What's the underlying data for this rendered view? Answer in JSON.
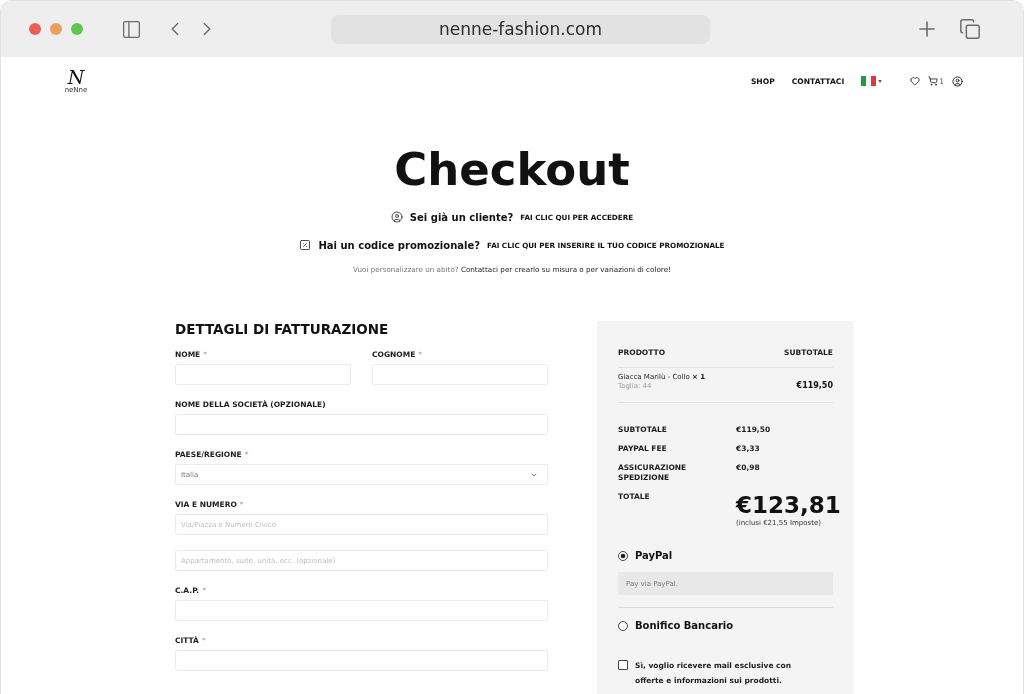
{
  "browser": {
    "url": "nenne-fashion.com"
  },
  "header": {
    "logo": {
      "letter": "N",
      "wordmark": "neNne"
    },
    "nav": [
      "SHOP",
      "CONTATTACI"
    ],
    "cart_count": "1"
  },
  "title": "Checkout",
  "notices": [
    {
      "kind": "login",
      "question": "Sei già un cliente?",
      "link": "FAI CLIC QUI PER ACCEDERE"
    },
    {
      "kind": "coupon",
      "question": "Hai un codice promozionale?",
      "link": "FAI CLIC QUI PER INSERIRE IL TUO CODICE PROMOZIONALE"
    }
  ],
  "custom_note": {
    "text": "Vuoi personalizzare un abito?",
    "link": "Contattaci per crearlo su misura o per variazioni di colore!"
  },
  "billing": {
    "title": "DETTAGLI DI FATTURAZIONE",
    "rows": [
      {
        "fields": [
          {
            "kind": "text",
            "label": "NOME",
            "mark": "*"
          },
          {
            "kind": "text",
            "label": "COGNOME",
            "mark": "*"
          }
        ]
      },
      {
        "fields": [
          {
            "kind": "text",
            "label": "NOME DELLA SOCIETÀ (OPZIONALE)"
          }
        ]
      },
      {
        "fields": [
          {
            "kind": "select",
            "label": "PAESE/REGIONE",
            "mark": "*",
            "value": "Italia"
          }
        ]
      },
      {
        "fields": [
          {
            "kind": "text",
            "label": "VIA E NUMERO",
            "mark": "*",
            "placeholder": "Via/Piazza e Numero Civico"
          }
        ]
      },
      {
        "fields": [
          {
            "kind": "text",
            "placeholder": "Appartamento, suite, unità, ecc. (opzionale)"
          }
        ]
      },
      {
        "fields": [
          {
            "kind": "text",
            "label": "C.A.P.",
            "mark": "*"
          }
        ]
      },
      {
        "fields": [
          {
            "kind": "text",
            "label": "CITTÀ",
            "mark": "*"
          }
        ]
      }
    ]
  },
  "order": {
    "columns": [
      "PRODOTTO",
      "SUBTOTALE"
    ],
    "items": [
      {
        "name": "Giacca Marilù - Collo **× 1**",
        "meta": "Taglia: 44",
        "price": "€119,50"
      }
    ],
    "totals": [
      {
        "label": "SUBTOTALE",
        "value": "€119,50"
      },
      {
        "label": "PAYPAL FEE",
        "value": "€3,33"
      },
      {
        "label": "ASSICURAZIONE SPEDIZIONE",
        "value": "€0,98"
      }
    ],
    "grand_total": {
      "label": "TOTALE",
      "value": "€123,81",
      "note": "(inclusi €21,55 Imposte)"
    }
  },
  "payment_methods": [
    {
      "label": "PayPal",
      "selected": true,
      "description": "Pay via PayPal."
    },
    {
      "label": "Bonifico Bancario",
      "selected": false
    }
  ],
  "newsletter": {
    "label": "Sì, voglio ricevere mail esclusive con offerte e informazioni sui prodotti.",
    "checked": false
  }
}
